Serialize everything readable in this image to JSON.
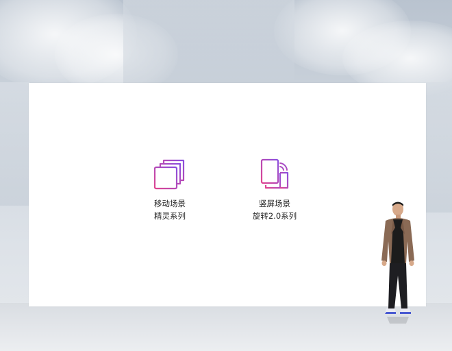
{
  "features": [
    {
      "icon": "stacked-cards-icon",
      "line1": "移动场景",
      "line2": "精灵系列"
    },
    {
      "icon": "portrait-rotation-icon",
      "line1": "竖屏场景",
      "line2": "旋转2.0系列"
    }
  ],
  "colors": {
    "icon_gradient_start": "#e0458f",
    "icon_gradient_end": "#8a4fe0",
    "screen": "#ffffff"
  }
}
